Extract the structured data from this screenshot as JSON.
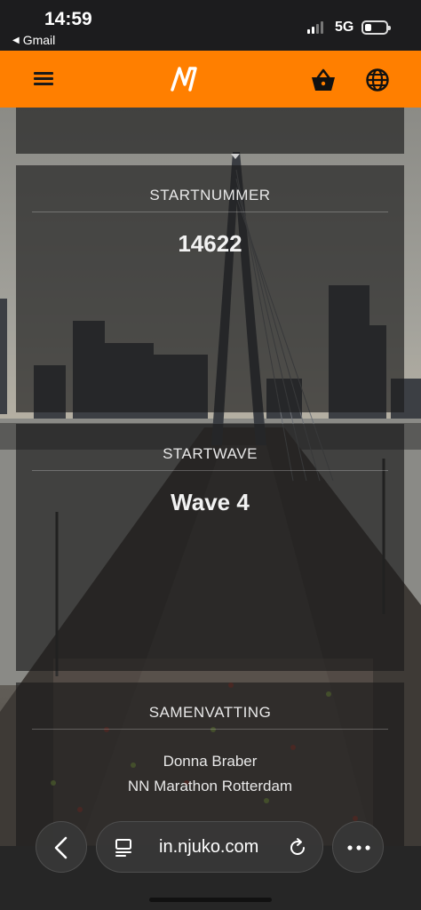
{
  "status_bar": {
    "time": "14:59",
    "back_app": "Gmail",
    "network": "5G"
  },
  "app_header": {
    "brand_color": "#ff7f00",
    "icons": [
      "menu-icon",
      "njuko-logo",
      "basket-icon",
      "globe-icon"
    ]
  },
  "cards": {
    "startnummer": {
      "label": "STARTNUMMER",
      "value": "14622"
    },
    "startwave": {
      "label": "STARTWAVE",
      "value": "Wave 4"
    },
    "samenvatting": {
      "label": "SAMENVATTING",
      "lines": [
        "Donna Braber",
        "NN Marathon Rotterdam"
      ]
    }
  },
  "browser": {
    "url": "in.njuko.com",
    "icons": [
      "chevron-left-icon",
      "tabs-icon",
      "reload-icon",
      "more-icon"
    ]
  }
}
